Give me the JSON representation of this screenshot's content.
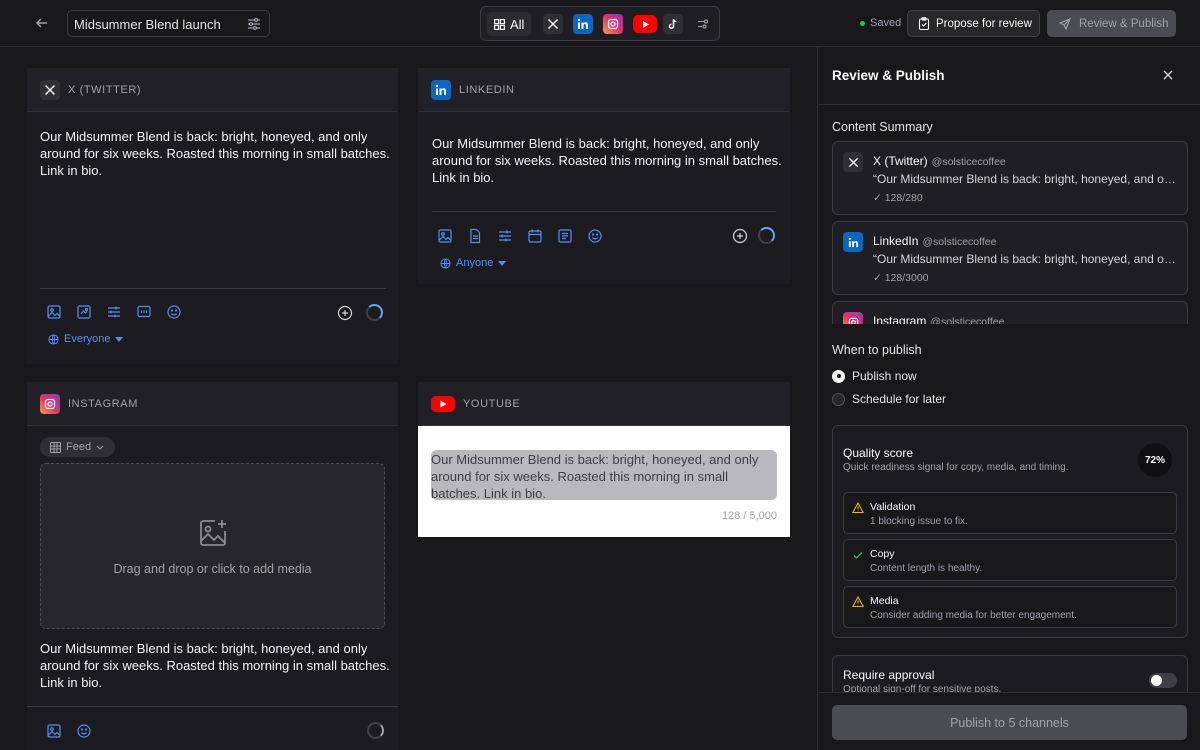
{
  "topbar": {
    "post_title": "Midsummer Blend launch",
    "channel_filter_all": "All",
    "saved_status": "Saved",
    "propose_label": "Propose for review",
    "review_publish_label": "Review & Publish"
  },
  "post_copy": "Our Midsummer Blend is back: bright, honeyed, and only around for six weeks. Roasted this morning in small batches. Link in bio.",
  "cards": {
    "x": {
      "header": "X (TWITTER)",
      "audience": "Everyone"
    },
    "linkedin": {
      "header": "LINKEDIN",
      "audience": "Anyone"
    },
    "instagram": {
      "header": "INSTAGRAM",
      "format": "Feed",
      "dropzone": "Drag and drop or click to add media"
    },
    "youtube": {
      "header": "YOUTUBE",
      "count": "128 / 5,000"
    }
  },
  "panel": {
    "title": "Review & Publish",
    "summary_label": "Content Summary",
    "summary": [
      {
        "name": "X (Twitter)",
        "handle": "@solsticecoffee",
        "quote": "“Our Midsummer Blend is back: bright, honeyed, and only around for six weeks. Roasted this morning in small batches. Link in bio.”",
        "count": "✓ 128/280"
      },
      {
        "name": "LinkedIn",
        "handle": "@solsticecoffee",
        "quote": "“Our Midsummer Blend is back: bright, honeyed, and only around for six weeks. Roasted this morning in small batches. Link in bio.”",
        "count": "✓ 128/3000"
      },
      {
        "name": "Instagram",
        "handle": "@solsticecoffee"
      }
    ],
    "when_label": "When to publish",
    "publish_now": "Publish now",
    "schedule_later": "Schedule for later",
    "quality": {
      "title": "Quality score",
      "subtitle": "Quick readiness signal for copy, media, and timing.",
      "score": "72%",
      "items": [
        {
          "title": "Validation",
          "detail": "1 blocking issue to fix.",
          "status": "warning"
        },
        {
          "title": "Copy",
          "detail": "Content length is healthy.",
          "status": "ok"
        },
        {
          "title": "Media",
          "detail": "Consider adding media for better engagement.",
          "status": "warning"
        }
      ]
    },
    "approval": {
      "title": "Require approval",
      "subtitle": "Optional sign-off for sensitive posts.",
      "enabled": false
    },
    "publish_button": "Publish to 5 channels"
  },
  "colors": {
    "accent": "#4f8ff7",
    "warning": "#eab308",
    "ok": "#22c55e"
  }
}
